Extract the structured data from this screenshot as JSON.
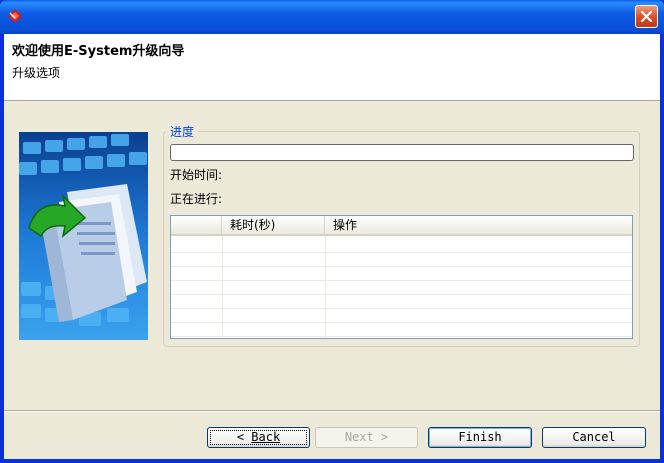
{
  "window": {
    "icon": "app-logo-icon",
    "close_icon": "close-icon"
  },
  "header": {
    "title": "欢迎使用E-System升级向导",
    "subtitle": "升级选项"
  },
  "progress_group": {
    "label": "进度",
    "start_time_label": "开始时间:",
    "in_progress_label": "正在进行:",
    "progress_value": 0
  },
  "table": {
    "columns": [
      "",
      "耗时(秒)",
      "操作"
    ],
    "rows": []
  },
  "buttons": {
    "back_label": "Back",
    "next_label": "Next",
    "finish_label": "Finish",
    "cancel_label": "Cancel"
  },
  "colors": {
    "title_bar": "#0a52e0",
    "close_button": "#d94a26",
    "group_label": "#0046d5",
    "face": "#ece9d8"
  }
}
